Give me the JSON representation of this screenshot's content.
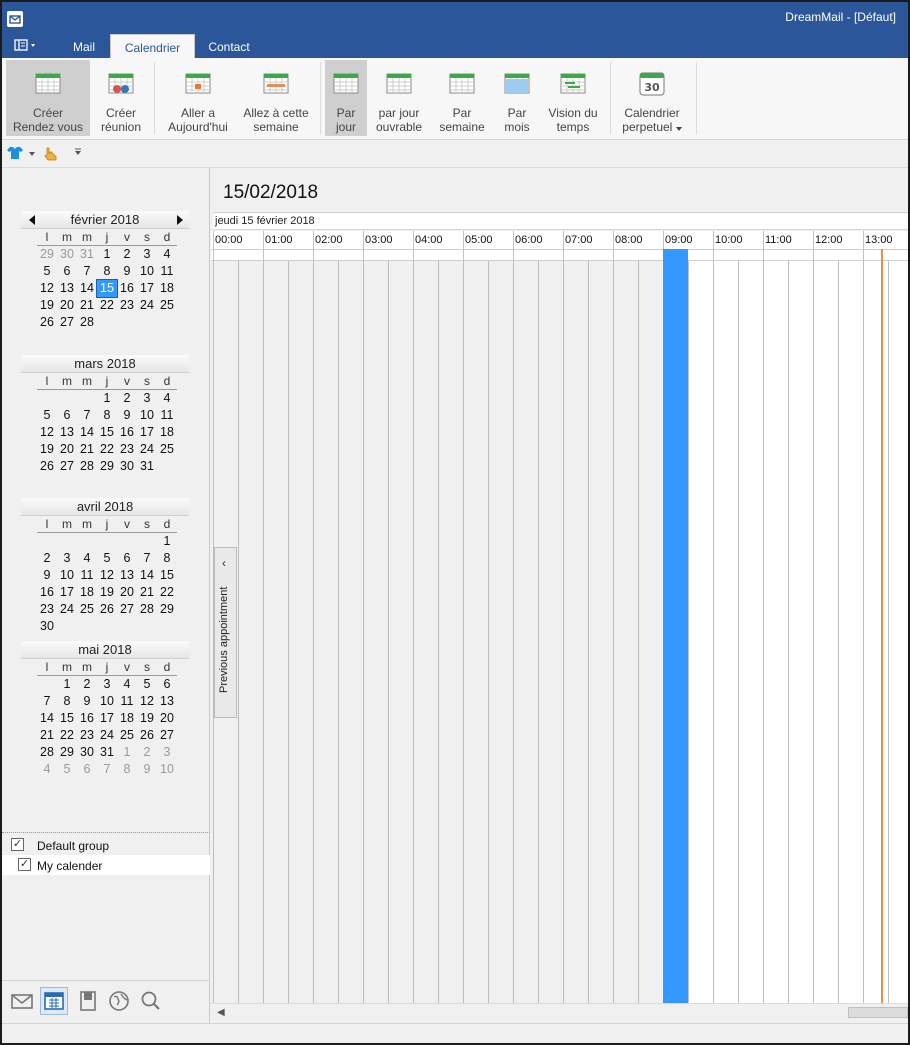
{
  "window": {
    "title": "DreamMail - [Défaut]"
  },
  "tabs": [
    "Mail",
    "Calendrier",
    "Contact"
  ],
  "active_tab": "Calendrier",
  "ribbon": [
    {
      "line1": "Créer",
      "line2": "Rendez vous",
      "icon": "calendar-add-icon",
      "pressed": true
    },
    {
      "line1": "Créer",
      "line2": "réunion",
      "icon": "meeting-icon",
      "pressed": false
    },
    {
      "line1": "Aller a",
      "line2": "Aujourd'hui",
      "icon": "calendar-today-icon",
      "pressed": false
    },
    {
      "line1": "Allez à cette",
      "line2": "semaine",
      "icon": "calendar-week-icon",
      "pressed": false
    },
    {
      "line1": "Par",
      "line2": "jour",
      "icon": "calendar-day-icon",
      "pressed": true
    },
    {
      "line1": "par jour",
      "line2": "ouvrable",
      "icon": "calendar-workday-icon",
      "pressed": false
    },
    {
      "line1": "Par",
      "line2": "semaine",
      "icon": "calendar-week-view-icon",
      "pressed": false
    },
    {
      "line1": "Par",
      "line2": "mois",
      "icon": "calendar-month-icon",
      "pressed": false
    },
    {
      "line1": "Vision du",
      "line2": "temps",
      "icon": "timeline-icon",
      "pressed": false
    },
    {
      "line1": "Calendrier",
      "line2": "perpetuel",
      "icon": "perpetual-calendar-icon",
      "pressed": false,
      "dropdown": true,
      "icon_text": "30"
    }
  ],
  "weekday_headers": [
    "l",
    "m",
    "m",
    "j",
    "v",
    "s",
    "d"
  ],
  "mini_calendars": [
    {
      "title": "février 2018",
      "nav": true,
      "rows": [
        [
          {
            "d": "29",
            "o": 1
          },
          {
            "d": "30",
            "o": 1
          },
          {
            "d": "31",
            "o": 1
          },
          {
            "d": "1"
          },
          {
            "d": "2"
          },
          {
            "d": "3"
          },
          {
            "d": "4"
          }
        ],
        [
          {
            "d": "5"
          },
          {
            "d": "6"
          },
          {
            "d": "7"
          },
          {
            "d": "8"
          },
          {
            "d": "9"
          },
          {
            "d": "10"
          },
          {
            "d": "11"
          }
        ],
        [
          {
            "d": "12"
          },
          {
            "d": "13"
          },
          {
            "d": "14"
          },
          {
            "d": "15",
            "t": 1
          },
          {
            "d": "16"
          },
          {
            "d": "17"
          },
          {
            "d": "18"
          }
        ],
        [
          {
            "d": "19"
          },
          {
            "d": "20"
          },
          {
            "d": "21"
          },
          {
            "d": "22"
          },
          {
            "d": "23"
          },
          {
            "d": "24"
          },
          {
            "d": "25"
          }
        ],
        [
          {
            "d": "26"
          },
          {
            "d": "27"
          },
          {
            "d": "28"
          },
          {
            "d": ""
          },
          {
            "d": ""
          },
          {
            "d": ""
          },
          {
            "d": ""
          }
        ]
      ]
    },
    {
      "title": "mars 2018",
      "nav": false,
      "rows": [
        [
          {
            "d": ""
          },
          {
            "d": ""
          },
          {
            "d": ""
          },
          {
            "d": "1"
          },
          {
            "d": "2"
          },
          {
            "d": "3"
          },
          {
            "d": "4"
          }
        ],
        [
          {
            "d": "5"
          },
          {
            "d": "6"
          },
          {
            "d": "7"
          },
          {
            "d": "8"
          },
          {
            "d": "9"
          },
          {
            "d": "10"
          },
          {
            "d": "11"
          }
        ],
        [
          {
            "d": "12"
          },
          {
            "d": "13"
          },
          {
            "d": "14"
          },
          {
            "d": "15"
          },
          {
            "d": "16"
          },
          {
            "d": "17"
          },
          {
            "d": "18"
          }
        ],
        [
          {
            "d": "19"
          },
          {
            "d": "20"
          },
          {
            "d": "21"
          },
          {
            "d": "22"
          },
          {
            "d": "23"
          },
          {
            "d": "24"
          },
          {
            "d": "25"
          }
        ],
        [
          {
            "d": "26"
          },
          {
            "d": "27"
          },
          {
            "d": "28"
          },
          {
            "d": "29"
          },
          {
            "d": "30"
          },
          {
            "d": "31"
          },
          {
            "d": ""
          }
        ]
      ]
    },
    {
      "title": "avril 2018",
      "nav": false,
      "rows": [
        [
          {
            "d": ""
          },
          {
            "d": ""
          },
          {
            "d": ""
          },
          {
            "d": ""
          },
          {
            "d": ""
          },
          {
            "d": ""
          },
          {
            "d": "1"
          }
        ],
        [
          {
            "d": "2"
          },
          {
            "d": "3"
          },
          {
            "d": "4"
          },
          {
            "d": "5"
          },
          {
            "d": "6"
          },
          {
            "d": "7"
          },
          {
            "d": "8"
          }
        ],
        [
          {
            "d": "9"
          },
          {
            "d": "10"
          },
          {
            "d": "11"
          },
          {
            "d": "12"
          },
          {
            "d": "13"
          },
          {
            "d": "14"
          },
          {
            "d": "15"
          }
        ],
        [
          {
            "d": "16"
          },
          {
            "d": "17"
          },
          {
            "d": "18"
          },
          {
            "d": "19"
          },
          {
            "d": "20"
          },
          {
            "d": "21"
          },
          {
            "d": "22"
          }
        ],
        [
          {
            "d": "23"
          },
          {
            "d": "24"
          },
          {
            "d": "25"
          },
          {
            "d": "26"
          },
          {
            "d": "27"
          },
          {
            "d": "28"
          },
          {
            "d": "29"
          }
        ],
        [
          {
            "d": "30"
          },
          {
            "d": ""
          },
          {
            "d": ""
          },
          {
            "d": ""
          },
          {
            "d": ""
          },
          {
            "d": ""
          },
          {
            "d": ""
          }
        ]
      ]
    },
    {
      "title": "mai 2018",
      "nav": false,
      "rows": [
        [
          {
            "d": ""
          },
          {
            "d": "1"
          },
          {
            "d": "2"
          },
          {
            "d": "3"
          },
          {
            "d": "4"
          },
          {
            "d": "5"
          },
          {
            "d": "6"
          }
        ],
        [
          {
            "d": "7"
          },
          {
            "d": "8"
          },
          {
            "d": "9"
          },
          {
            "d": "10"
          },
          {
            "d": "11"
          },
          {
            "d": "12"
          },
          {
            "d": "13"
          }
        ],
        [
          {
            "d": "14"
          },
          {
            "d": "15"
          },
          {
            "d": "16"
          },
          {
            "d": "17"
          },
          {
            "d": "18"
          },
          {
            "d": "19"
          },
          {
            "d": "20"
          }
        ],
        [
          {
            "d": "21"
          },
          {
            "d": "22"
          },
          {
            "d": "23"
          },
          {
            "d": "24"
          },
          {
            "d": "25"
          },
          {
            "d": "26"
          },
          {
            "d": "27"
          }
        ],
        [
          {
            "d": "28"
          },
          {
            "d": "29"
          },
          {
            "d": "30"
          },
          {
            "d": "31"
          },
          {
            "d": "1",
            "o": 1
          },
          {
            "d": "2",
            "o": 1
          },
          {
            "d": "3",
            "o": 1
          }
        ],
        [
          {
            "d": "4",
            "o": 1
          },
          {
            "d": "5",
            "o": 1
          },
          {
            "d": "6",
            "o": 1
          },
          {
            "d": "7",
            "o": 1
          },
          {
            "d": "8",
            "o": 1
          },
          {
            "d": "9",
            "o": 1
          },
          {
            "d": "10",
            "o": 1
          }
        ]
      ]
    }
  ],
  "groups": [
    {
      "label": "Default group",
      "checked": true
    },
    {
      "label": "My calender",
      "checked": true
    }
  ],
  "nav_icons": [
    "mail-icon",
    "calendar-icon",
    "contacts-book-icon",
    "rss-globe-icon",
    "search-icon"
  ],
  "main": {
    "date_title": "15/02/2018",
    "day_header": "jeudi 15 février 2018",
    "hours": [
      "00:00",
      "01:00",
      "02:00",
      "03:00",
      "04:00",
      "05:00",
      "06:00",
      "07:00",
      "08:00",
      "09:00",
      "10:00",
      "11:00",
      "12:00",
      "13:00"
    ],
    "selected_slot": "09:00",
    "previous_appointment": "Previous appointment"
  },
  "colors": {
    "title_bar": "#2b579a",
    "selection": "#3399ff",
    "now_line": "#e8904a"
  }
}
